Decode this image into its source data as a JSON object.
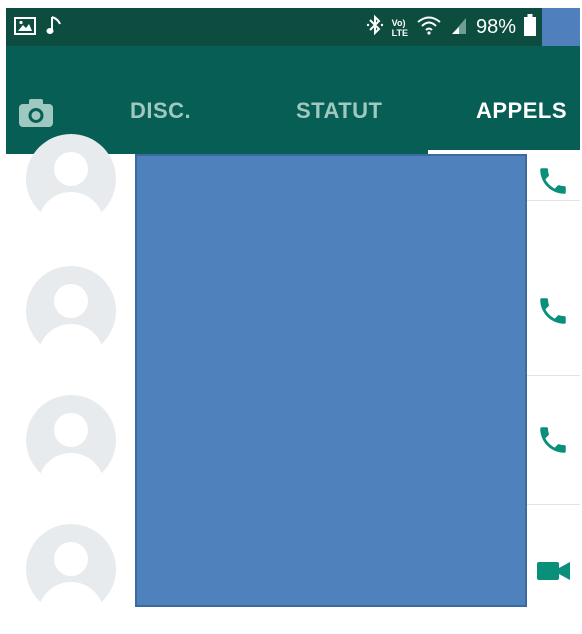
{
  "status_bar": {
    "battery": "98%",
    "icons": [
      "image-icon",
      "music-note-icon",
      "bluetooth-icon",
      "volte-icon",
      "wifi-icon",
      "signal-icon",
      "battery-icon"
    ],
    "volte_text_top": "Vo)",
    "volte_text_bottom": "LTE"
  },
  "tabs": [
    {
      "label": "DISC.",
      "active": false
    },
    {
      "label": "STATUT",
      "active": false
    },
    {
      "label": "APPELS",
      "active": true
    }
  ],
  "colors": {
    "appbar": "#075e54",
    "statusbar": "#0d4d40",
    "accent": "#0a8f7b",
    "redaction": "#4f81bd"
  },
  "call_rows": [
    {
      "call_type": "voice"
    },
    {
      "call_type": "voice"
    },
    {
      "call_type": "voice"
    },
    {
      "call_type": "video"
    }
  ]
}
